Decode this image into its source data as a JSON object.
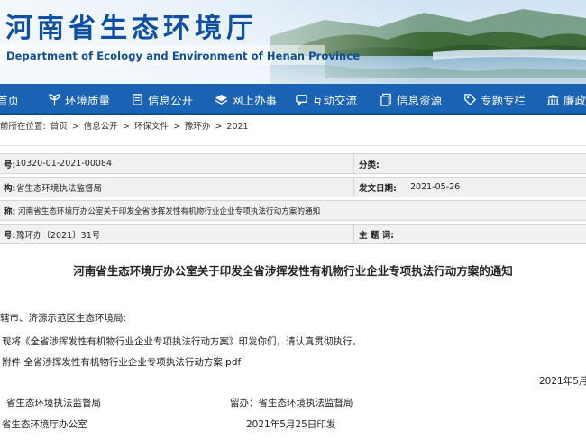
{
  "header": {
    "title_cn": "河南省生态环境厅",
    "title_en": "Department of Ecology and Environment of Henan Province"
  },
  "nav": {
    "items": [
      {
        "label": "首页",
        "icon": "home-icon"
      },
      {
        "label": "环境质量",
        "icon": "sprout-icon"
      },
      {
        "label": "信息公开",
        "icon": "document-icon"
      },
      {
        "label": "网上办事",
        "icon": "layers-icon"
      },
      {
        "label": "互动交流",
        "icon": "chat-icon"
      },
      {
        "label": "信息资源",
        "icon": "files-icon"
      },
      {
        "label": "专题专栏",
        "icon": "tag-icon"
      },
      {
        "label": "廉政",
        "icon": "bank-icon"
      }
    ]
  },
  "breadcrumb": {
    "prefix": "前所在位置:",
    "items": [
      "首页",
      "信息公开",
      "环保文件",
      "豫环办",
      "2021"
    ],
    "separator": ">"
  },
  "meta": {
    "index_label": "号:",
    "index_value": "10320-01-2021-00084",
    "category_label": "分类:",
    "category_value": "",
    "org_label": "构:",
    "org_value": "省生态环境执法监督局",
    "date_label": "发文日期:",
    "date_value": "2021-05-26",
    "name_label": "称:",
    "name_value": "河南省生态环境厅办公室关于印发全省涉挥发性有机物行业企业专项执法行动方案的通知",
    "docno_label": "号:",
    "docno_value": "豫环办〔2021〕31号",
    "subject_label": "主 题 词:",
    "subject_value": ""
  },
  "document": {
    "title": "河南省生态环境厅办公室关于印发全省涉挥发性有机物行业企业专项执法行动方案的通知",
    "recipients": "辖市、济源示范区生态环境局:",
    "body": "现将《全省涉挥发性有机物行业企业专项执法行动方案》印发你们，请认真贯彻执行。",
    "attachment": "附件 全省涉挥发性有机物行业企业专项执法行动方案.pdf",
    "sign_date": "2021年5月",
    "cc_left": "省生态环境执法监督局",
    "cc_right": "留办：省生态环境执法监督局",
    "issuer": "省生态环境厅办公室",
    "issue_date": "2021年5月25日印发"
  },
  "colors": {
    "nav_bg": "#1a62b3",
    "title_blue": "#0d4fa0",
    "meta_bg": "#f1f1f1"
  }
}
